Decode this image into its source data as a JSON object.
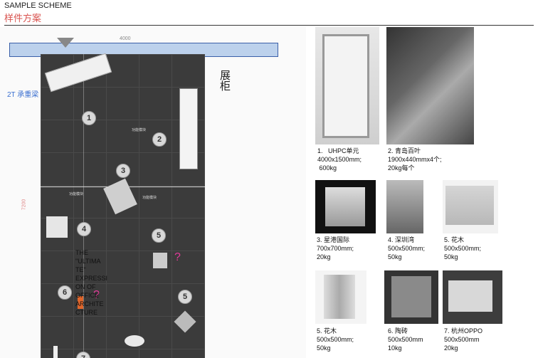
{
  "header": {
    "title_en": "SAMPLE SCHEME",
    "title_cn": "样件方案"
  },
  "plan": {
    "dim_top": "4000",
    "dim_left": "7200",
    "beam_label": "2T 承重梁",
    "cabinet_label": "展柜",
    "expression_text": "THE \"ULTIMA TE\" EXPRESSI ON OF OFFICE ARCHITE CTURE",
    "markers": [
      "1",
      "2",
      "3",
      "4",
      "5",
      "5",
      "6",
      "7"
    ],
    "question": "?",
    "small_labels": [
      "功能模块",
      "功能模块",
      "功能模块"
    ]
  },
  "samples": [
    {
      "num": "1.",
      "name": "UHPC单元",
      "spec": "4000x1500mm;",
      "weight": "600kg"
    },
    {
      "num": "2.",
      "name": "青岛百叶",
      "spec": "1900x440mmx4个;",
      "weight": "20kg每个"
    },
    {
      "num": "3.",
      "name": "星港国际",
      "spec": "700x700mm;",
      "weight": "20kg"
    },
    {
      "num": "4.",
      "name": "深圳湾",
      "spec": "500x500mm;",
      "weight": "50kg"
    },
    {
      "num": "5.",
      "name": "花木",
      "spec": "500x500mm;",
      "weight": "50kg"
    },
    {
      "num": "5.",
      "name": "花木",
      "spec": "500x500mm;",
      "weight": "50kg"
    },
    {
      "num": "6.",
      "name": "陶砖",
      "spec": "500x500mm",
      "weight": "10kg"
    },
    {
      "num": "7.",
      "name": "杭州OPPO",
      "spec": "500x500mm",
      "weight": "20kg"
    }
  ]
}
